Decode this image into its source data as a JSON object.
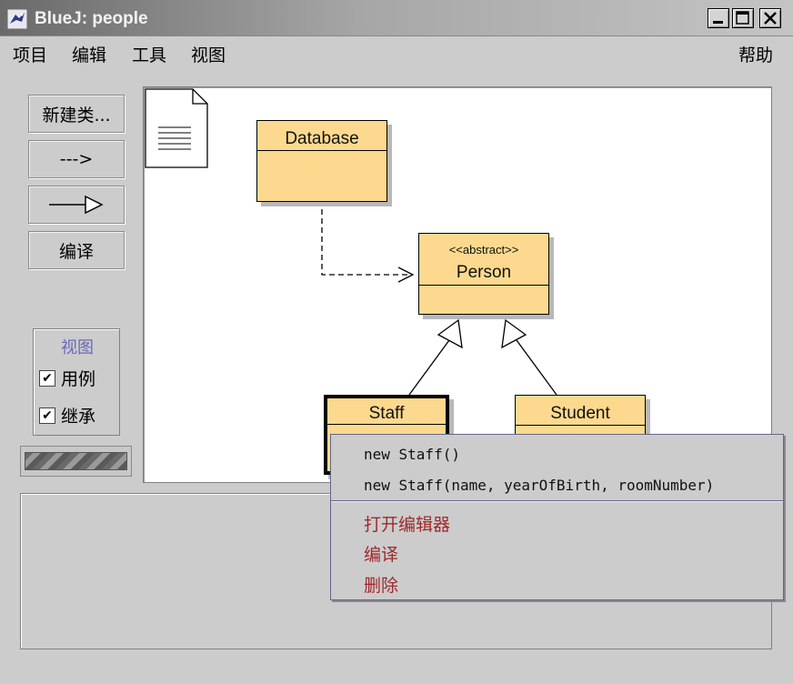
{
  "window": {
    "title": "BlueJ: people"
  },
  "menubar": {
    "items": [
      "项目",
      "编辑",
      "工具",
      "视图"
    ],
    "help": "帮助"
  },
  "toolbar": {
    "new_class": "新建类...",
    "dependency_arrow": "--->",
    "compile": "编译"
  },
  "view_panel": {
    "title": "视图",
    "uses_label": "用例",
    "uses_checked": true,
    "inheritance_label": "继承",
    "inheritance_checked": true
  },
  "classes": {
    "database": {
      "name": "Database"
    },
    "person": {
      "stereotype": "<<abstract>>",
      "name": "Person"
    },
    "staff": {
      "name": "Staff"
    },
    "student": {
      "name": "Student"
    }
  },
  "context_menu": {
    "constructors": [
      "new Staff()",
      "new Staff(name, yearOfBirth, roomNumber)"
    ],
    "actions": [
      "打开编辑器",
      "编译",
      "删除"
    ]
  },
  "colors": {
    "class_fill": "#fcd98e",
    "menu_action": "#a0282c",
    "view_title": "#6a6ab8"
  }
}
